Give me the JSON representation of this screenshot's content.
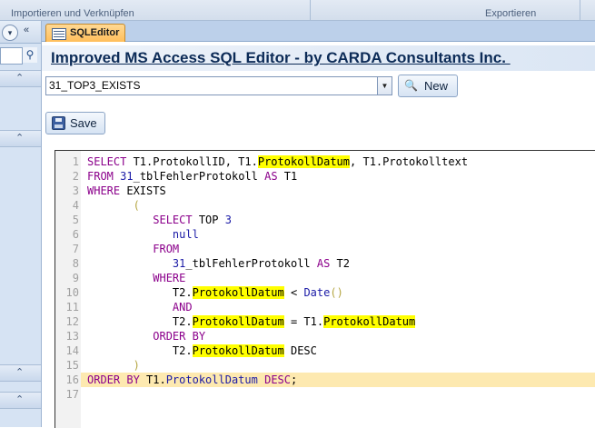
{
  "ribbon": {
    "group_left": "Importieren und Verknüpfen",
    "group_right": "Exportieren"
  },
  "nav": {
    "collapse_glyph": "«",
    "dropdown_glyph": "▾",
    "search_glyph": "⚲"
  },
  "tab": {
    "label": "SQLEditor"
  },
  "form": {
    "title": "Improved MS Access SQL Editor - by CARDA Consultants Inc. ",
    "query_select": {
      "value": "31_TOP3_EXISTS"
    },
    "new_button": "New",
    "save_button": "Save"
  },
  "editor": {
    "current_line": 16,
    "lines": [
      [
        [
          "SELECT",
          "kw"
        ],
        [
          " T1.ProtokollID, T1.",
          ""
        ],
        [
          "ProtokollDatum",
          "hl"
        ],
        [
          ", T1.Protokolltext",
          ""
        ]
      ],
      [
        [
          "FROM",
          "kw"
        ],
        [
          " ",
          ""
        ],
        [
          "31",
          "fn"
        ],
        [
          "_tblFehlerProtokoll ",
          ""
        ],
        [
          "AS",
          "kw"
        ],
        [
          " T1",
          ""
        ]
      ],
      [
        [
          "WHERE",
          "kw"
        ],
        [
          " EXISTS",
          ""
        ]
      ],
      [
        [
          "       ",
          ""
        ],
        [
          "(",
          "par"
        ]
      ],
      [
        [
          "          ",
          ""
        ],
        [
          "SELECT",
          "kw"
        ],
        [
          " TOP ",
          ""
        ],
        [
          "3",
          "fn"
        ]
      ],
      [
        [
          "             ",
          ""
        ],
        [
          "null",
          "fn"
        ]
      ],
      [
        [
          "          ",
          ""
        ],
        [
          "FROM",
          "kw"
        ]
      ],
      [
        [
          "             ",
          ""
        ],
        [
          "31",
          "fn"
        ],
        [
          "_tblFehlerProtokoll ",
          ""
        ],
        [
          "AS",
          "kw"
        ],
        [
          " T2",
          ""
        ]
      ],
      [
        [
          "          ",
          ""
        ],
        [
          "WHERE",
          "kw"
        ]
      ],
      [
        [
          "             T2.",
          ""
        ],
        [
          "ProtokollDatum",
          "hl"
        ],
        [
          " < ",
          ""
        ],
        [
          "Date",
          "fn"
        ],
        [
          "()",
          "par"
        ]
      ],
      [
        [
          "             ",
          ""
        ],
        [
          "AND",
          "kw"
        ]
      ],
      [
        [
          "             T2.",
          ""
        ],
        [
          "ProtokollDatum",
          "hl"
        ],
        [
          " = T1.",
          ""
        ],
        [
          "ProtokollDatum",
          "hl"
        ]
      ],
      [
        [
          "          ",
          ""
        ],
        [
          "ORDER BY",
          "kw"
        ]
      ],
      [
        [
          "             T2.",
          ""
        ],
        [
          "ProtokollDatum",
          "hl"
        ],
        [
          " DESC",
          ""
        ]
      ],
      [
        [
          "       ",
          ""
        ],
        [
          ")",
          "par"
        ]
      ],
      [
        [
          "ORDER BY",
          "kw"
        ],
        [
          " T1.",
          ""
        ],
        [
          "ProtokollDatum",
          "fn"
        ],
        [
          " ",
          ""
        ],
        [
          "DESC",
          "kw"
        ],
        [
          ";",
          ""
        ]
      ],
      []
    ]
  }
}
